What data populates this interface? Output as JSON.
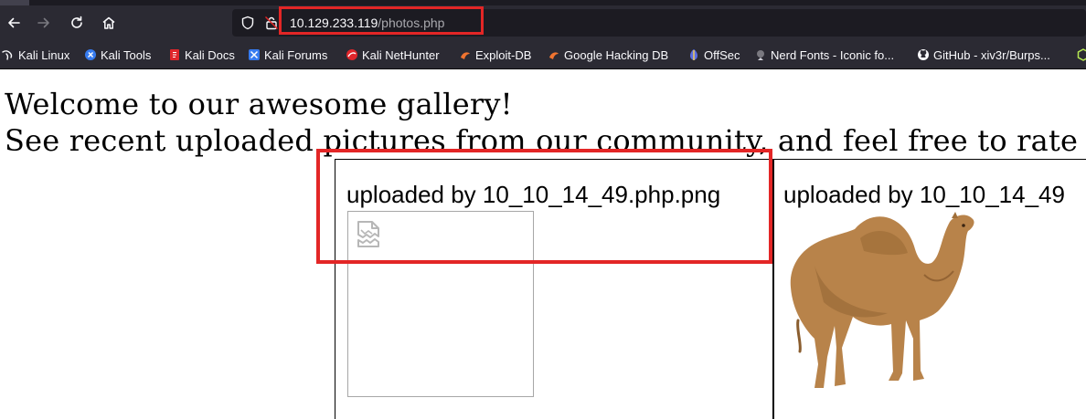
{
  "browser": {
    "url_host": "10.129.233.119",
    "url_path": "/photos.php",
    "bookmarks": [
      {
        "label": "Kali Linux",
        "icon": "kali-dragon-icon"
      },
      {
        "label": "Kali Tools",
        "icon": "kali-tools-icon"
      },
      {
        "label": "Kali Docs",
        "icon": "kali-docs-icon"
      },
      {
        "label": "Kali Forums",
        "icon": "kali-forums-icon"
      },
      {
        "label": "Kali NetHunter",
        "icon": "nethunter-icon"
      },
      {
        "label": "Exploit-DB",
        "icon": "exploit-db-icon"
      },
      {
        "label": "Google Hacking DB",
        "icon": "ghdb-icon"
      },
      {
        "label": "OffSec",
        "icon": "offsec-icon"
      },
      {
        "label": "Nerd Fonts - Iconic fo...",
        "icon": "nerd-fonts-icon"
      },
      {
        "label": "GitHub - xiv3r/Burps...",
        "icon": "github-icon"
      }
    ],
    "colors": {
      "chrome": "#2b2a33",
      "urlbar": "#1c1b22",
      "highlight": "#e32626"
    }
  },
  "page": {
    "welcome": "Welcome to our awesome gallery!",
    "intro": "See recent uploaded pictures from our community, and feel free to rate",
    "gallery": [
      {
        "caption": "uploaded by 10_10_14_49.php.png",
        "image": "broken-image-icon"
      },
      {
        "caption": "uploaded by 10_10_14_49",
        "image": "camel-photo"
      }
    ]
  }
}
